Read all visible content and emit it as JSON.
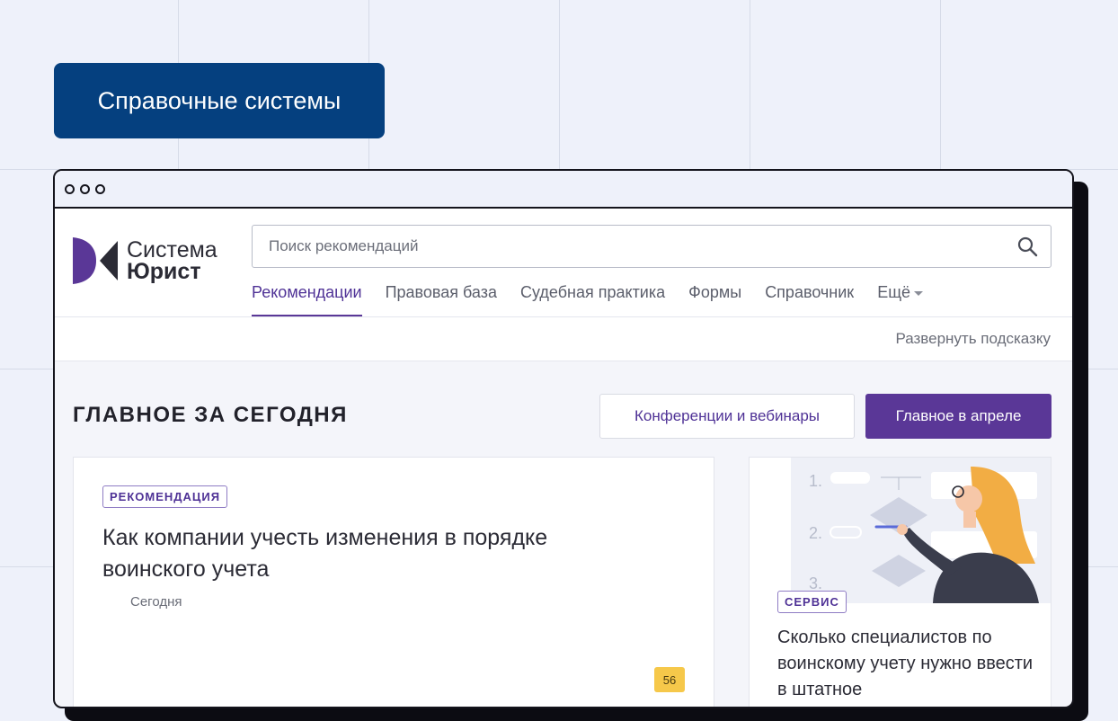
{
  "hero": {
    "label": "Справочные системы"
  },
  "app": {
    "logo": {
      "line1": "Система",
      "line2": "Юрист"
    },
    "search": {
      "placeholder": "Поиск рекомендаций"
    },
    "nav": [
      {
        "label": "Рекомендации",
        "active": true
      },
      {
        "label": "Правовая база"
      },
      {
        "label": "Судебная практика"
      },
      {
        "label": "Формы"
      },
      {
        "label": "Справочник"
      },
      {
        "label": "Ещё"
      }
    ],
    "hint_link": "Развернуть подсказку"
  },
  "main": {
    "section_title": "ГЛАВНОЕ ЗА СЕГОДНЯ",
    "btn_conferences": "Конференции и вебинары",
    "btn_main_april": "Главное в апреле",
    "card_main": {
      "tag": "РЕКОМЕНДАЦИЯ",
      "title": "Как компании учесть изменения в порядке воинского учета",
      "date": "Сегодня",
      "count": "56"
    },
    "card_side": {
      "tag": "СЕРВИС",
      "title": "Сколько специалистов по воинскому учету нужно ввести в штатное",
      "illustration_labels": [
        "1.",
        "2.",
        "3."
      ]
    }
  },
  "colors": {
    "brand_purple": "#5a3797",
    "hero_blue": "#05407f",
    "badge_yellow": "#f6c84a"
  }
}
